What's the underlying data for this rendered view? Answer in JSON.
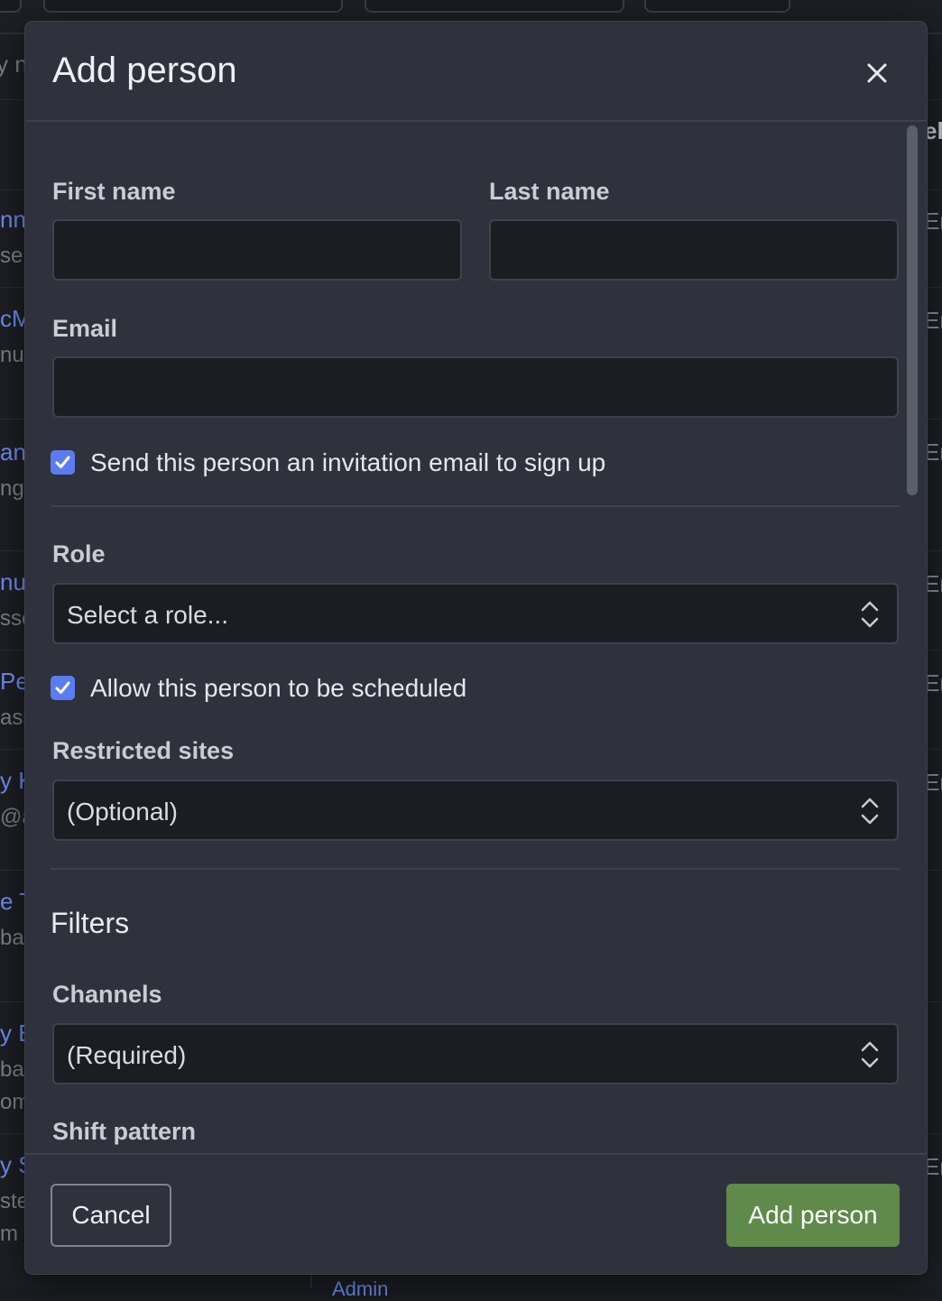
{
  "background": {
    "search_fragment": "y n",
    "column_header_fragment": "el",
    "rows": [
      {
        "name": "nn",
        "sub": "ser",
        "right": "Er"
      },
      {
        "name": "cM",
        "sub": "nul",
        "right": "Er"
      },
      {
        "name": "an",
        "sub": "ng(",
        "right": "Er"
      },
      {
        "name": "nu",
        "sub": "sse",
        "right": "Er"
      },
      {
        "name": "Pe(",
        "sub": "ass",
        "right": "Er"
      },
      {
        "name": "y K",
        "sub": "@as",
        "right": "Er"
      },
      {
        "name": "e T",
        "sub": "ba",
        "right": ""
      },
      {
        "name": "y B",
        "sub": "ba",
        "sub2": "om",
        "right": ""
      },
      {
        "name": "y S",
        "sub": "ste",
        "sub2": "m",
        "right": "Er"
      }
    ],
    "bottom_fragment": "Admin"
  },
  "modal": {
    "title": "Add person",
    "close_label": "×",
    "fields": {
      "first_name": {
        "label": "First name",
        "value": "",
        "placeholder": ""
      },
      "last_name": {
        "label": "Last name",
        "value": "",
        "placeholder": ""
      },
      "email": {
        "label": "Email",
        "value": "",
        "placeholder": ""
      },
      "send_invite": {
        "label": "Send this person an invitation email to sign up",
        "checked": true
      },
      "role": {
        "label": "Role",
        "value": "Select a role..."
      },
      "allow_scheduled": {
        "label": "Allow this person to be scheduled",
        "checked": true
      },
      "restricted_sites": {
        "label": "Restricted sites",
        "value": "(Optional)"
      },
      "filters_title": "Filters",
      "channels": {
        "label": "Channels",
        "value": "(Required)"
      },
      "shift_pattern": {
        "label": "Shift pattern"
      }
    },
    "footer": {
      "cancel_label": "Cancel",
      "submit_label": "Add person"
    }
  },
  "colors": {
    "accent_checkbox": "#5b7cf0",
    "primary_button": "#5f8a4a",
    "modal_bg": "#2f323c",
    "input_bg": "#1c1d22",
    "link_blue": "#6f8ef5"
  },
  "icons": {
    "close": "close-icon",
    "checkmark": "checkmark-icon",
    "select": "chevron-up-down-icon"
  }
}
